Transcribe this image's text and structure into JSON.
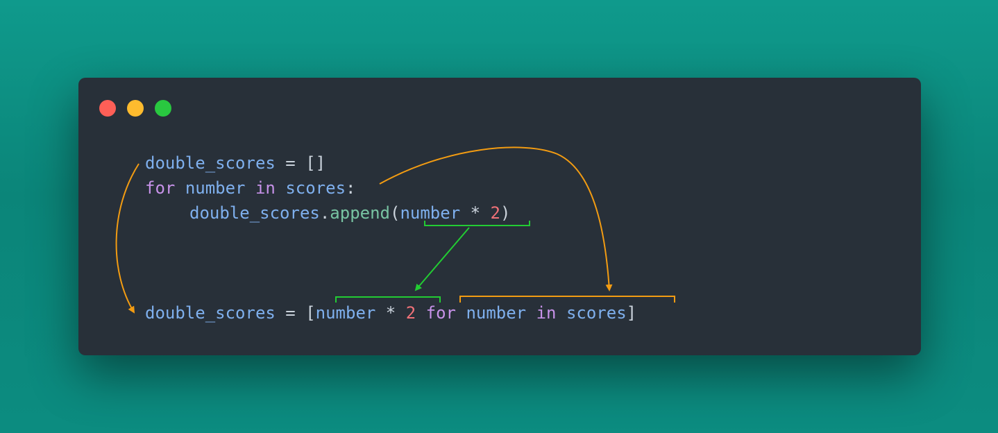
{
  "window": {
    "controls": [
      {
        "name": "close",
        "color": "#fe5f57"
      },
      {
        "name": "minimize",
        "color": "#febb2e"
      },
      {
        "name": "maximize",
        "color": "#29c840"
      }
    ]
  },
  "code": {
    "line1": {
      "var": "double_scores",
      "eq": " = ",
      "brackets": "[]"
    },
    "line2": {
      "kw_for": "for",
      "var": "number",
      "kw_in": "in",
      "iter": "scores",
      "colon": ":"
    },
    "line3": {
      "obj": "double_scores",
      "dot": ".",
      "method": "append",
      "open": "(",
      "arg": "number",
      "op": " * ",
      "num": "2",
      "close": ")"
    },
    "line4": {
      "var": "double_scores",
      "eq": " = ",
      "open": "[",
      "expr_var": "number",
      "op": " * ",
      "num": "2",
      "kw_for": "for",
      "loop_var": "number",
      "kw_in": "in",
      "iter": "scores",
      "close": "]"
    }
  },
  "annotations": {
    "orange_color": "#f39c12",
    "green_color": "#22cc33"
  }
}
